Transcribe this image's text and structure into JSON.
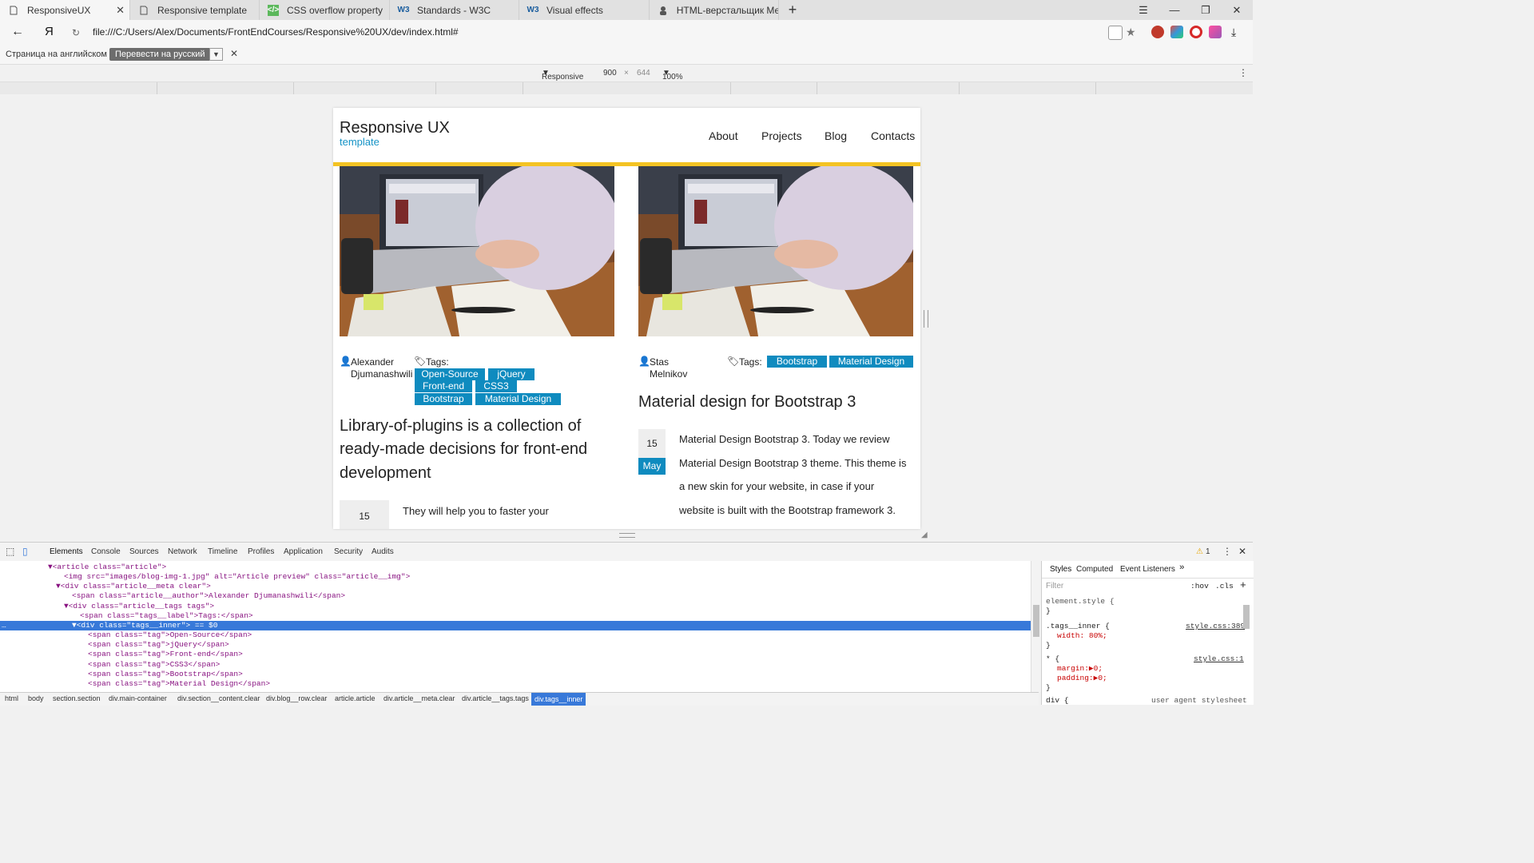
{
  "tabs": [
    {
      "title": "ResponsiveUX",
      "icon": "page-icon",
      "active": true
    },
    {
      "title": "Responsive template",
      "icon": "page-icon",
      "active": false
    },
    {
      "title": "CSS overflow property",
      "icon": "css-icon",
      "active": false
    },
    {
      "title": "Standards - W3C",
      "icon": "w3c-icon",
      "active": false
    },
    {
      "title": "Visual effects",
      "icon": "w3c-icon",
      "active": false
    },
    {
      "title": "HTML-верстальщик Мельн",
      "icon": "person-icon",
      "active": false
    }
  ],
  "browser": {
    "url": "file:///C:/Users/Alex/Documents/FrontEndCourses/Responsive%20UX/dev/index.html#",
    "yandex_label": "Я"
  },
  "translate": {
    "label": "Страница на английском",
    "button": "Перевести на русский"
  },
  "device": {
    "mode": "Responsive",
    "width": "900",
    "times": "×",
    "height": "644",
    "zoom": "100%"
  },
  "site": {
    "title": "Responsive UX",
    "subtitle": "template",
    "nav": [
      "About",
      "Projects",
      "Blog",
      "Contacts"
    ]
  },
  "articles": [
    {
      "author_line1": "Alexander",
      "author_line2": "Djumanashwili",
      "tags_label": "Tags:",
      "tags": [
        "Open-Source",
        "jQuery",
        "Front-end",
        "CSS3",
        "Bootstrap",
        "Material Design"
      ],
      "title_lines": [
        "Library-of-plugins is a collection of",
        "ready-made decisions for front-end",
        "development"
      ],
      "date_day": "15",
      "body_lines": [
        "They will help you to faster your"
      ]
    },
    {
      "author_line1": "Stas",
      "author_line2": "Melnikov",
      "tags_label": "Tags:",
      "tags": [
        "Bootstrap",
        "Material Design"
      ],
      "title_lines": [
        "Material design for Bootstrap 3"
      ],
      "date_day": "15",
      "date_month": "May",
      "body_lines": [
        "Material Design Bootstrap 3. Today we review",
        "Material Design Bootstrap 3 theme. This theme is",
        "a new skin for your website, in case if your",
        "website is built with the Bootstrap framework 3."
      ]
    }
  ],
  "devtools": {
    "tabs": [
      "Elements",
      "Console",
      "Sources",
      "Network",
      "Timeline",
      "Profiles",
      "Application",
      "Security",
      "Audits"
    ],
    "warning_count": "1",
    "code": [
      "<article class=\"article\">",
      "<img src=\"images/blog-img-1.jpg\" alt=\"Article preview\" class=\"article__img\">",
      "<div class=\"article__meta clear\">",
      "<span class=\"article__author\">Alexander Djumanashwili</span>",
      "<div class=\"article__tags tags\">",
      "<span class=\"tags__label\">Tags:</span>",
      "<div class=\"tags__inner\"> == $0",
      "<span class=\"tag\">Open-Source</span>",
      "<span class=\"tag\">jQuery</span>",
      "<span class=\"tag\">Front-end</span>",
      "<span class=\"tag\">CSS3</span>",
      "<span class=\"tag\">Bootstrap</span>",
      "<span class=\"tag\">Material Design</span>"
    ],
    "breadcrumbs": [
      "html",
      "body",
      "section.section",
      "div.main-container",
      "div.section__content.clear",
      "div.blog__row.clear",
      "article.article",
      "div.article__meta.clear",
      "div.article__tags.tags",
      "div.tags__inner"
    ],
    "styles_tabs": [
      "Styles",
      "Computed",
      "Event Listeners"
    ],
    "filter_placeholder": "Filter",
    "hov": ":hov",
    "cls": ".cls",
    "styles": [
      {
        "selector": "element.style {",
        "close": "}"
      },
      {
        "selector": ".tags__inner {",
        "source": "style.css:389",
        "props": [
          "width: 80%;"
        ],
        "close": "}"
      },
      {
        "selector": "* {",
        "source": "style.css:1",
        "props": [
          "margin:▶0;",
          "padding:▶0;"
        ],
        "close": "}"
      },
      {
        "selector": "div {",
        "source": "user agent stylesheet"
      }
    ]
  }
}
